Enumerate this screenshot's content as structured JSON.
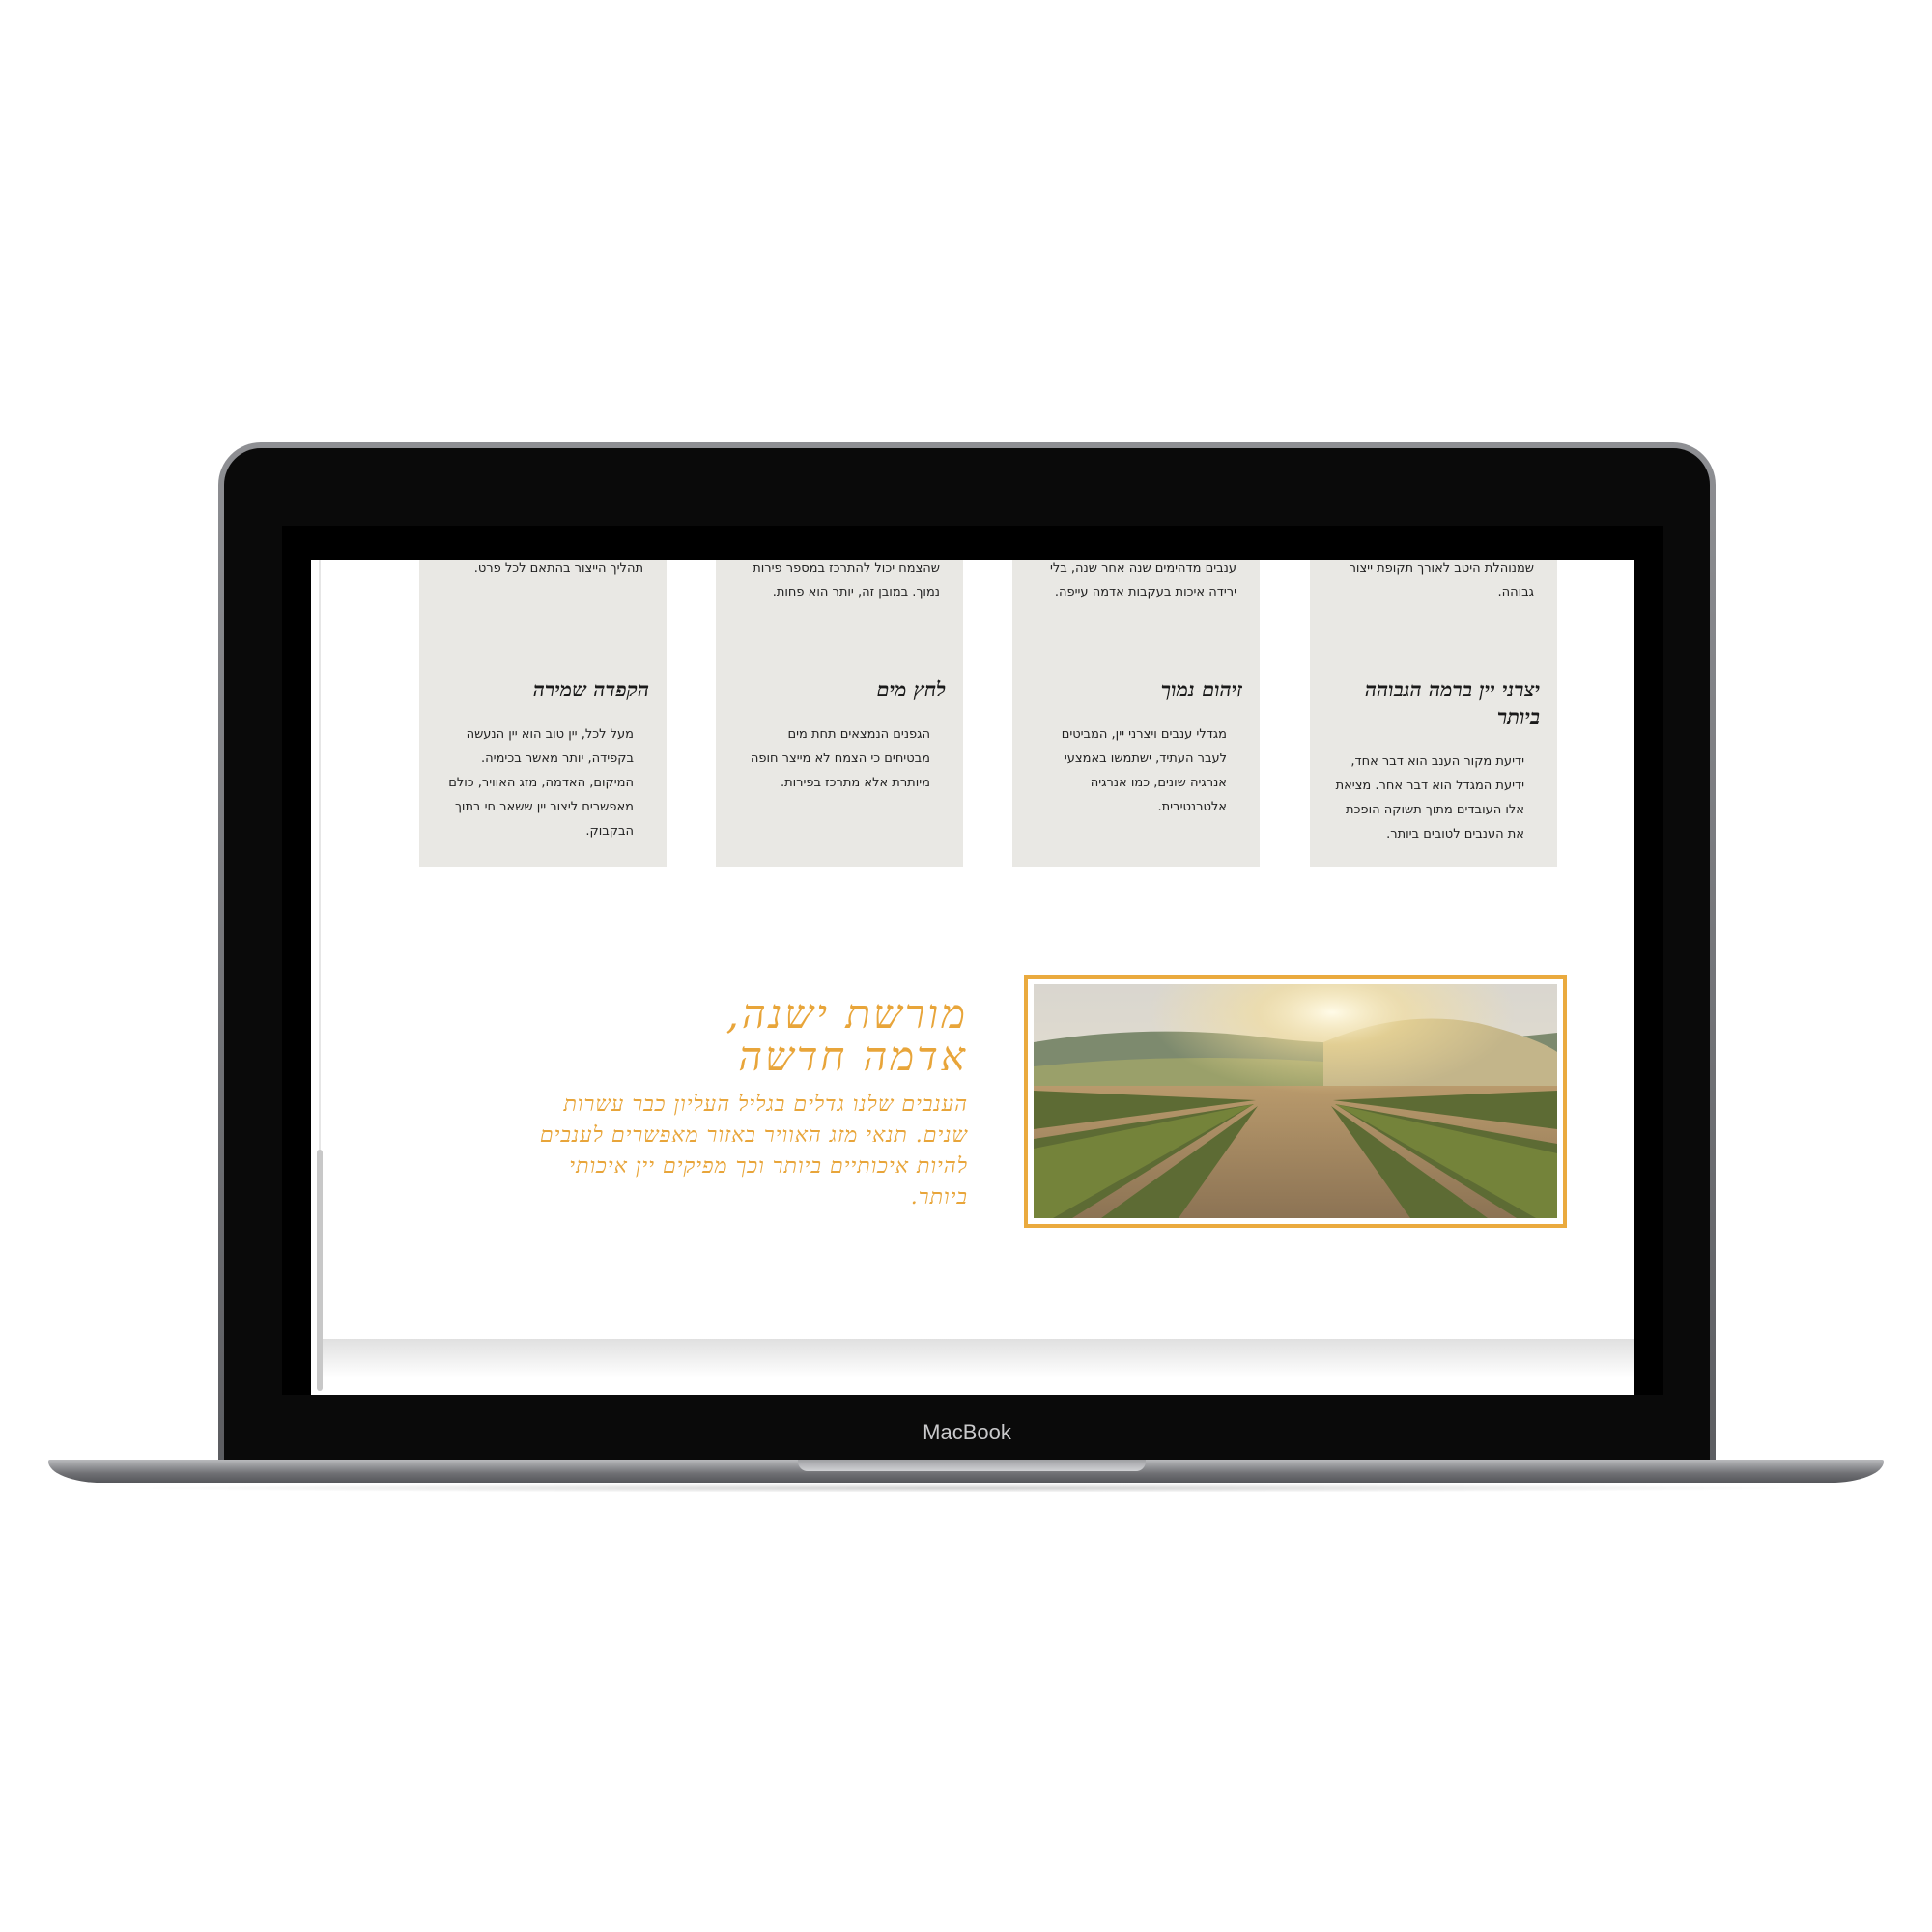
{
  "device": {
    "brand": "MacBook"
  },
  "cards": [
    {
      "top_text": "שמנוהלת היטב לאורך תקופת ייצור גבוהה.",
      "title": "יצרני יין ברמה הגבוהה ביותר",
      "body": "ידיעת מקור הענב הוא דבר אחד, ידיעת המגדל הוא דבר אחר. מציאת אלו העובדים מתוך תשוקה הופכת את הענבים לטובים ביותר."
    },
    {
      "top_text": "ענבים מדהימים שנה אחר שנה, בלי ירידה איכות בעקבות אדמה עייפה.",
      "title": "זיהום נמוך",
      "body": "מגדלי ענבים ויצרני יין, המביטים לעבר העתיד, ישתמשו באמצעי אנרגיה שונים, כמו אנרגיה אלטרנטיבית."
    },
    {
      "top_text": "שהצמח יכול להתרכז במספר פירות נמוך. במובן זה, יותר הוא פחות.",
      "title": "לחץ מים",
      "body": "הגפנים הנמצאים תחת מים מבטיחים כי הצמח לא מייצר חופה מיותרת אלא מתרכז בפירות."
    },
    {
      "top_text": "תהליך הייצור בהתאם לכל פרט.",
      "title": "הקפדה שמירה",
      "body": "מעל לכל, יין טוב הוא יין הנעשה בקפידה, יותר מאשר בכימיה. המיקום, האדמה, מזג האוויר, כולם מאפשרים ליצור יין ששאר חי בתוך הבקבוק."
    }
  ],
  "heritage": {
    "heading_line1": "מורשת ישנה,",
    "heading_line2": "אדמה חדשה",
    "description": "הענבים שלנו גדלים בגליל העליון כבר עשרות שנים. תנאי מזג האוויר באזור מאפשרים לענבים להיות איכותיים ביותר וכך מפיקים יין איכותי ביותר."
  },
  "image": {
    "subject": "vineyard-rows-at-sunset"
  },
  "colors": {
    "accent": "#e8a53a",
    "card_bg": "#e9e8e4",
    "frame": "#eaaa3e"
  }
}
